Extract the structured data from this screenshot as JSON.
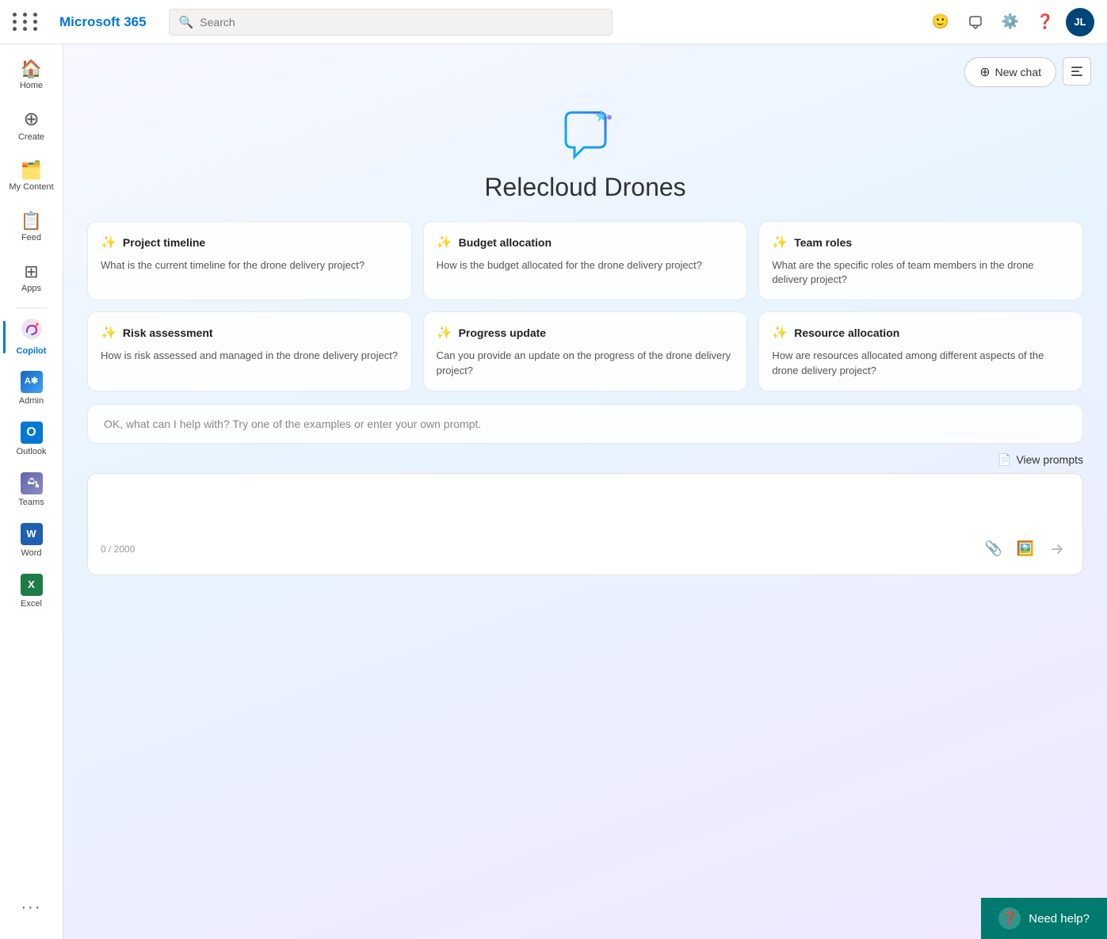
{
  "topbar": {
    "title": "Microsoft 365",
    "search_placeholder": "Search",
    "avatar_initials": "JL"
  },
  "sidebar": {
    "items": [
      {
        "id": "home",
        "label": "Home",
        "icon": "🏠"
      },
      {
        "id": "create",
        "label": "Create",
        "icon": "➕"
      },
      {
        "id": "mycontent",
        "label": "My Content",
        "icon": "📄"
      },
      {
        "id": "feed",
        "label": "Feed",
        "icon": "📋"
      },
      {
        "id": "apps",
        "label": "Apps",
        "icon": "⊞"
      },
      {
        "id": "copilot",
        "label": "Copilot",
        "icon": "✦",
        "active": true
      },
      {
        "id": "admin",
        "label": "Admin",
        "icon": "A*"
      },
      {
        "id": "outlook",
        "label": "Outlook",
        "icon": "O"
      },
      {
        "id": "teams",
        "label": "Teams",
        "icon": "T"
      },
      {
        "id": "word",
        "label": "Word",
        "icon": "W"
      },
      {
        "id": "excel",
        "label": "Excel",
        "icon": "X"
      }
    ],
    "more_label": "···"
  },
  "copilot": {
    "new_chat_label": "New chat",
    "title": "Relecloud Drones",
    "prompt_placeholder": "OK, what can I help with? Try one of the examples or enter your own prompt.",
    "view_prompts_label": "View prompts",
    "counter": "0 / 2000",
    "cards": [
      {
        "id": "project-timeline",
        "title": "Project timeline",
        "body": "What is the current timeline for the drone delivery project?"
      },
      {
        "id": "budget-allocation",
        "title": "Budget allocation",
        "body": "How is the budget allocated for the drone delivery project?"
      },
      {
        "id": "team-roles",
        "title": "Team roles",
        "body": "What are the specific roles of team members in the drone delivery project?"
      },
      {
        "id": "risk-assessment",
        "title": "Risk assessment",
        "body": "How is risk assessed and managed in the drone delivery project?"
      },
      {
        "id": "progress-update",
        "title": "Progress update",
        "body": "Can you provide an update on the progress of the drone delivery project?"
      },
      {
        "id": "resource-allocation",
        "title": "Resource allocation",
        "body": "How are resources allocated among different aspects of the drone delivery project?"
      }
    ]
  },
  "need_help": {
    "label": "Need help?"
  }
}
